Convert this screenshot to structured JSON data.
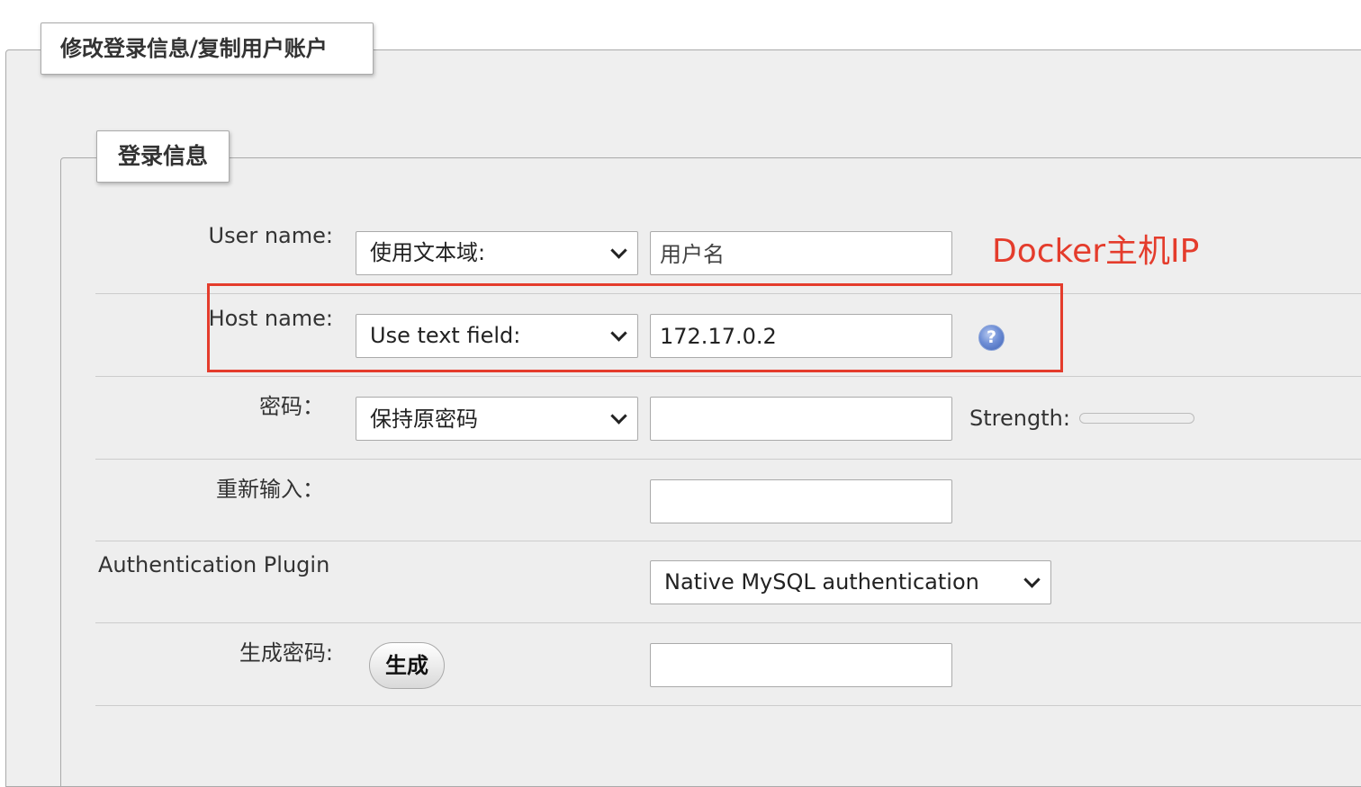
{
  "outer_legend": "修改登录信息/复制用户账户",
  "inner_legend": "登录信息",
  "rows": {
    "username": {
      "label": "User name:",
      "select_value": "使用文本域:",
      "input_value": "用户名"
    },
    "hostname": {
      "label": "Host name:",
      "select_value": "Use text field:",
      "input_value": "172.17.0.2",
      "help_icon": "question-circle-icon"
    },
    "password": {
      "label": "密码：",
      "select_value": "保持原密码",
      "input_value": "",
      "strength_label": "Strength:"
    },
    "retype": {
      "label": "重新输入：",
      "input_value": ""
    },
    "auth_plugin": {
      "label": "Authentication Plugin",
      "select_value": "Native MySQL authentication"
    },
    "generate": {
      "label": "生成密码:",
      "button_label": "生成",
      "input_value": ""
    }
  },
  "annotation": {
    "text": "Docker主机IP",
    "color": "#e43c2c"
  }
}
